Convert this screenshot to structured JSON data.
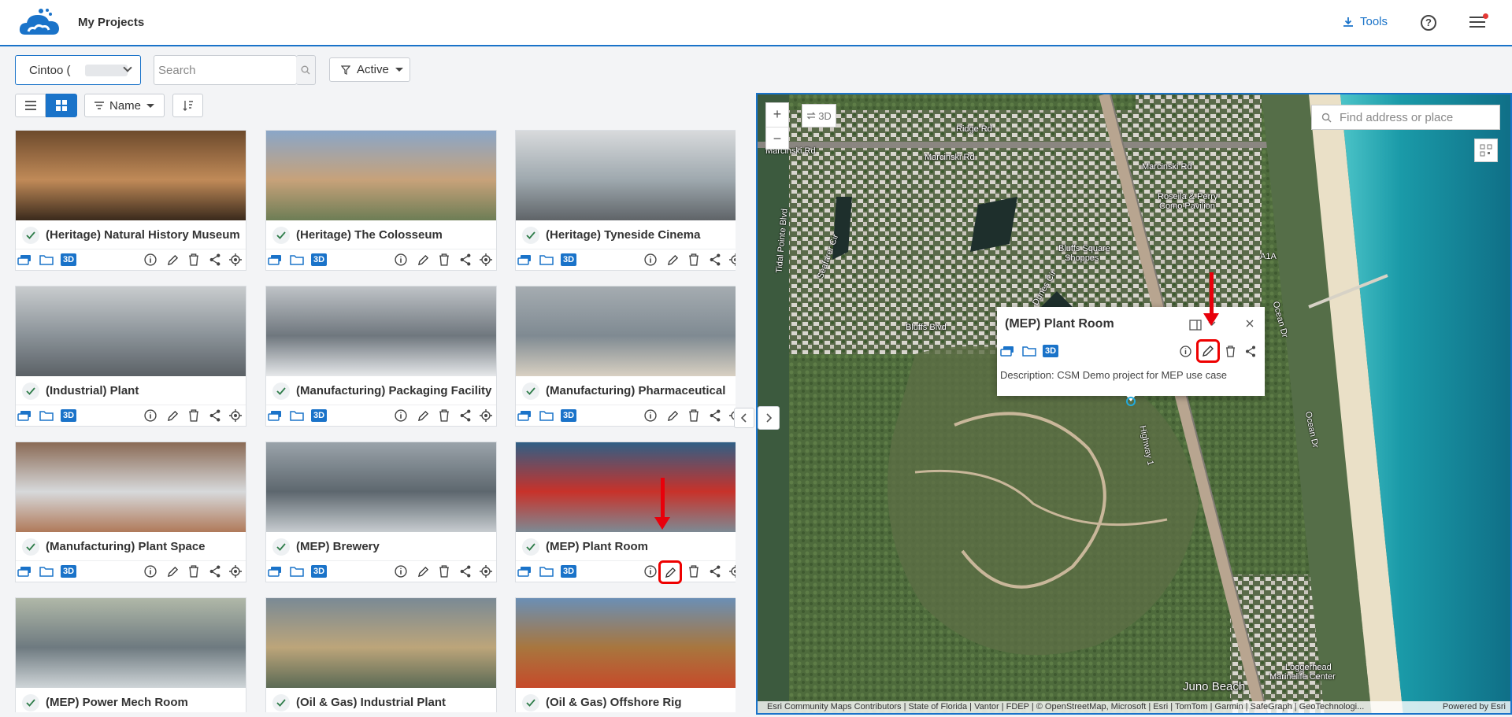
{
  "header": {
    "title": "My Projects",
    "tools_label": "Tools"
  },
  "toolbar": {
    "organization": "Cintoo (",
    "search_placeholder": "Search",
    "status_filter": "Active",
    "sort_label": "Name"
  },
  "projects": [
    {
      "name": "(Heritage) Natural History Museum"
    },
    {
      "name": "(Heritage) The Colosseum"
    },
    {
      "name": "(Heritage) Tyneside Cinema"
    },
    {
      "name": "(Industrial) Plant"
    },
    {
      "name": "(Manufacturing) Packaging Facility"
    },
    {
      "name": "(Manufacturing) Pharmaceutical"
    },
    {
      "name": "(Manufacturing) Plant Space"
    },
    {
      "name": "(MEP) Brewery"
    },
    {
      "name": "(MEP) Plant Room"
    },
    {
      "name": "(MEP) Power Mech Room"
    },
    {
      "name": "(Oil & Gas) Industrial Plant"
    },
    {
      "name": "(Oil & Gas) Offshore Rig"
    }
  ],
  "card_actions": {
    "badge_3d": "3D"
  },
  "map": {
    "toggle_3d": "3D",
    "search_placeholder": "Find address or place",
    "labels": {
      "l1": "Ridge Rd",
      "l2": "Marcinski Rd",
      "l3": "Marcinski Rd",
      "l4": "Marcinski Rd",
      "l5": "Roseila & Perry",
      "l6": "Como Pavilion",
      "l7": "Bluffs Square",
      "l8": "Shoppes",
      "l9": "A1A",
      "l10": "Bluffs Blvd",
      "l11": "Seafarer Cir",
      "l12": "Ocean Dr",
      "l13": "Juno Beach",
      "l14": "Loggerhead",
      "l15": "Marinelife Center",
      "l16": "Tidal Pointe Blvd",
      "l17": "Highway 1",
      "l18": "Ocean Dr",
      "l19": "Dunes Cir"
    },
    "popup": {
      "title": "(MEP) Plant Room",
      "badge_3d": "3D",
      "description": "Description: CSM Demo project for MEP use case"
    },
    "attribution": "Esri Community Maps Contributors | State of Florida | Vantor | FDEP | © OpenStreetMap, Microsoft | Esri | TomTom | Garmin | SafeGraph | GeoTechnologi...",
    "powered_by": "Powered by Esri"
  }
}
